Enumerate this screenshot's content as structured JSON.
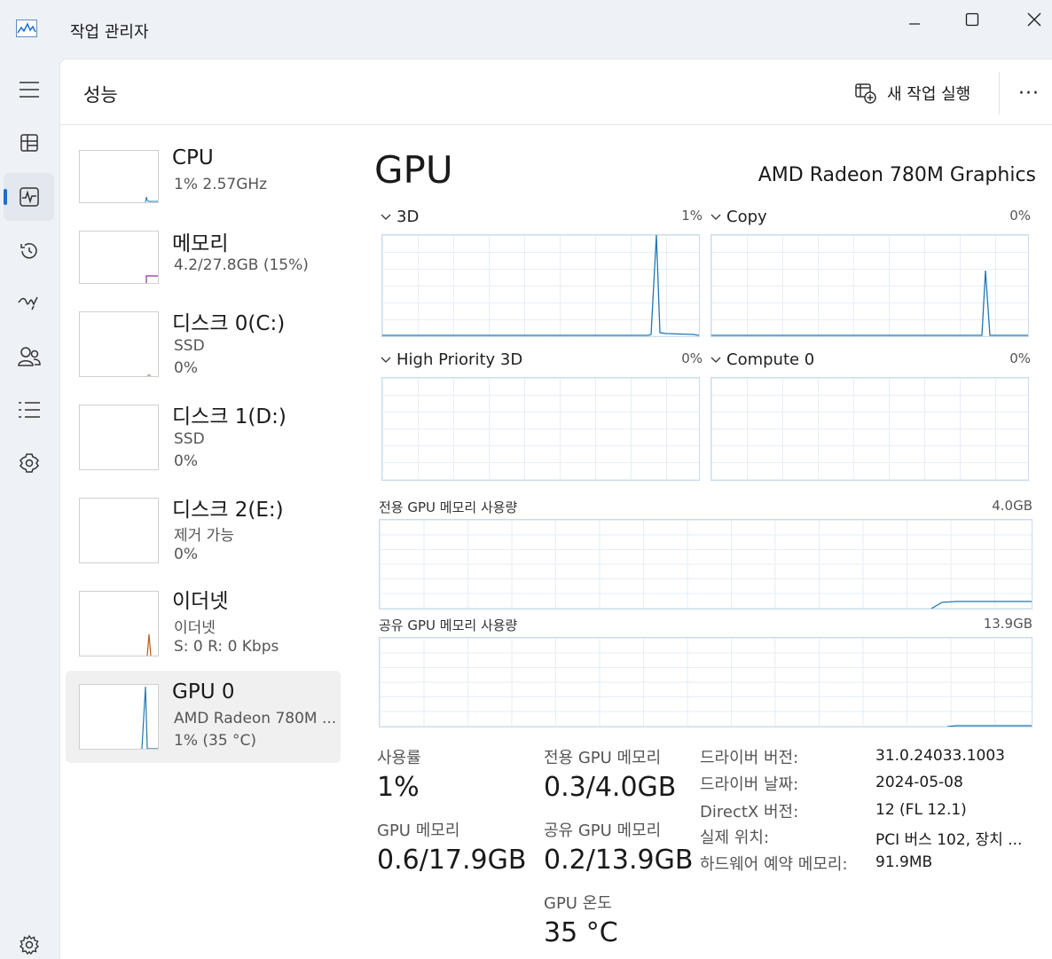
{
  "app": {
    "title": "작업 관리자"
  },
  "nav": {
    "items": [
      "menu-icon",
      "processes-icon",
      "performance-icon",
      "app-history-icon",
      "startup-icon",
      "users-icon",
      "details-icon",
      "services-icon",
      "settings-icon"
    ],
    "active": "performance-icon"
  },
  "header": {
    "title": "성능",
    "run_task": "새 작업 실행",
    "more": "···"
  },
  "devices": [
    {
      "name": "CPU",
      "line1": "1%  2.57GHz",
      "line2": ""
    },
    {
      "name": "메모리",
      "line1": "4.2/27.8GB (15%)",
      "line2": ""
    },
    {
      "name": "디스크 0(C:)",
      "line1": "SSD",
      "line2": "0%"
    },
    {
      "name": "디스크 1(D:)",
      "line1": "SSD",
      "line2": "0%"
    },
    {
      "name": "디스크 2(E:)",
      "line1": "제거 가능",
      "line2": "0%"
    },
    {
      "name": "이더넷",
      "line1": "이더넷",
      "line2": "S: 0  R: 0 Kbps"
    },
    {
      "name": "GPU 0",
      "line1": "AMD Radeon 780M ...",
      "line2": "1% (35 °C)"
    }
  ],
  "detail": {
    "title": "GPU",
    "model": "AMD Radeon 780M Graphics",
    "engines": [
      {
        "label": "3D",
        "pct": "1%"
      },
      {
        "label": "Copy",
        "pct": "0%"
      },
      {
        "label": "High Priority 3D",
        "pct": "0%"
      },
      {
        "label": "Compute 0",
        "pct": "0%"
      }
    ],
    "dedicated_label": "전용 GPU 메모리 사용량",
    "dedicated_cap": "4.0GB",
    "shared_label": "공유 GPU 메모리 사용량",
    "shared_cap": "13.9GB"
  },
  "stats": {
    "util_label": "사용률",
    "util_value": "1%",
    "ded_label": "전용 GPU 메모리",
    "ded_value": "0.3/4.0GB",
    "gpumem_label": "GPU 메모리",
    "gpumem_value": "0.6/17.9GB",
    "shared_label": "공유 GPU 메모리",
    "shared_value": "0.2/13.9GB",
    "temp_label": "GPU 온도",
    "temp_value": "35 °C"
  },
  "info": [
    {
      "label": "드라이버 버전:",
      "value": "31.0.24033.1003"
    },
    {
      "label": "드라이버 날짜:",
      "value": "2024-05-08"
    },
    {
      "label": "DirectX 버전:",
      "value": "12 (FL 12.1)"
    },
    {
      "label": "실제 위치:",
      "value": "PCI 버스 102, 장치 ..."
    },
    {
      "label": "하드웨어 예약 메모리:",
      "value": "91.9MB"
    }
  ],
  "colors": {
    "accent": "#1a6fd0",
    "gpu_line": "#1f77b4",
    "memory_line": "#8b2fa8",
    "ethernet_line": "#b85c1a",
    "disk_line": "#4a9a2a"
  }
}
